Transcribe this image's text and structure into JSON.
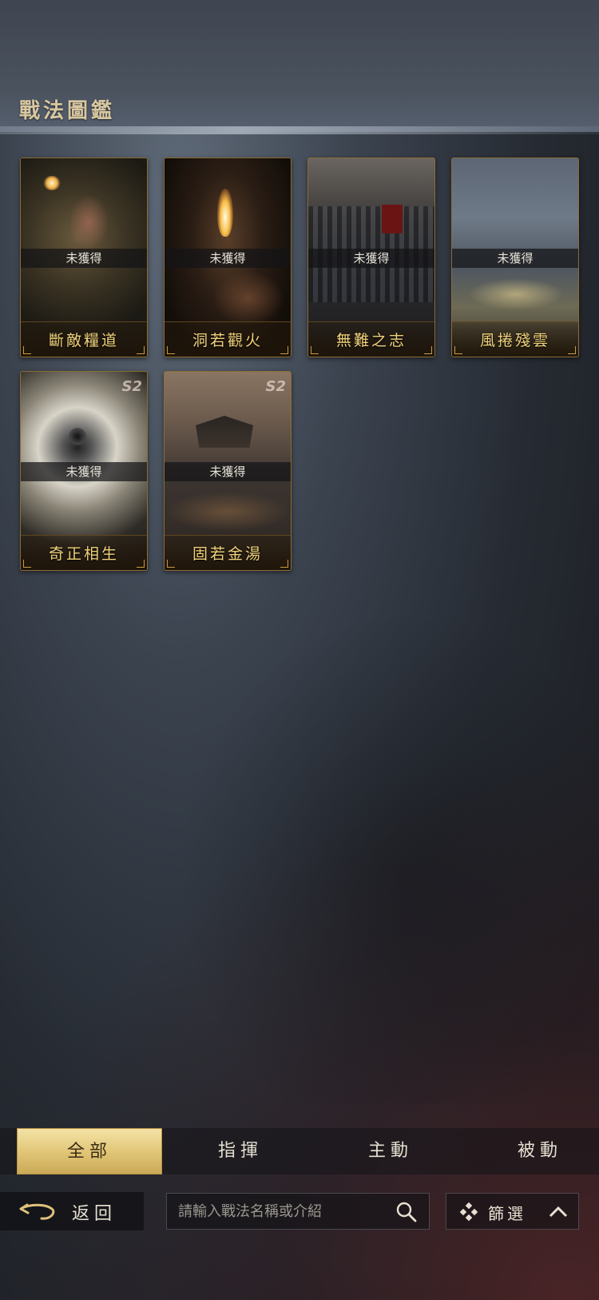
{
  "header": {
    "title": "戰法圖鑑"
  },
  "cards": [
    {
      "name": "斷敵糧道",
      "status": "未獲得",
      "season": ""
    },
    {
      "name": "洞若觀火",
      "status": "未獲得",
      "season": ""
    },
    {
      "name": "無難之志",
      "status": "未獲得",
      "season": ""
    },
    {
      "name": "風捲殘雲",
      "status": "未獲得",
      "season": ""
    },
    {
      "name": "奇正相生",
      "status": "未獲得",
      "season": "S2"
    },
    {
      "name": "固若金湯",
      "status": "未獲得",
      "season": "S2"
    }
  ],
  "tabs": [
    {
      "label": "全部",
      "active": true
    },
    {
      "label": "指揮",
      "active": false
    },
    {
      "label": "主動",
      "active": false
    },
    {
      "label": "被動",
      "active": false
    }
  ],
  "bottom": {
    "back_label": "返回",
    "search_placeholder": "請輸入戰法名稱或介紹",
    "search_value": "",
    "filter_label": "篩選"
  },
  "colors": {
    "accent_gold": "#f0d27a",
    "tab_active_bg": "#e2c779",
    "card_border": "#8c6d34"
  },
  "icons": [
    "back-arrow-icon",
    "search-icon",
    "filter-diamond-icon",
    "chevron-up-icon"
  ]
}
